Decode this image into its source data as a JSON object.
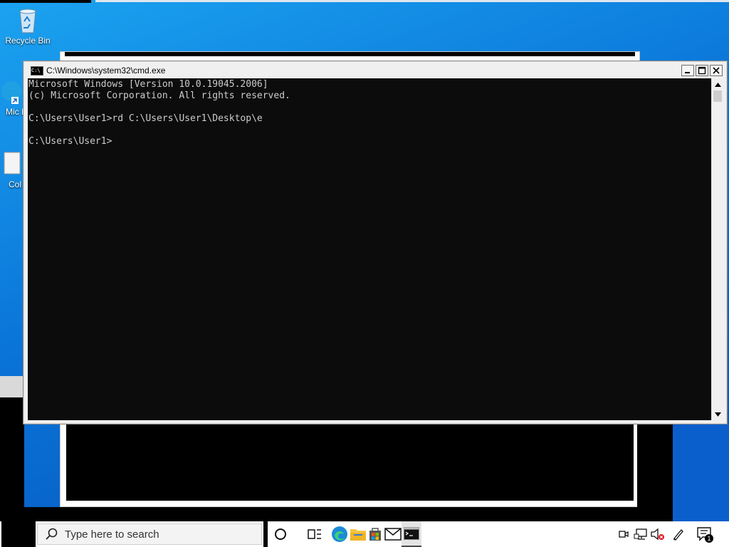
{
  "desktop": {
    "icons": [
      {
        "label": "Recycle Bin"
      },
      {
        "label": "Mic E"
      },
      {
        "label": "Col"
      }
    ]
  },
  "cmd": {
    "title": "C:\\Windows\\system32\\cmd.exe",
    "icon_text": "C:\\",
    "lines": [
      "Microsoft Windows [Version 10.0.19045.2006]",
      "(c) Microsoft Corporation. All rights reserved.",
      "",
      "C:\\Users\\User1>rd C:\\Users\\User1\\Desktop\\e",
      "",
      "C:\\Users\\User1>"
    ]
  },
  "taskbar": {
    "search_placeholder": "Type here to search",
    "notification_count": "1"
  },
  "colors": {
    "console_bg": "#0c0c0c",
    "console_fg": "#cccccc",
    "wallpaper": "#0a74d8"
  }
}
